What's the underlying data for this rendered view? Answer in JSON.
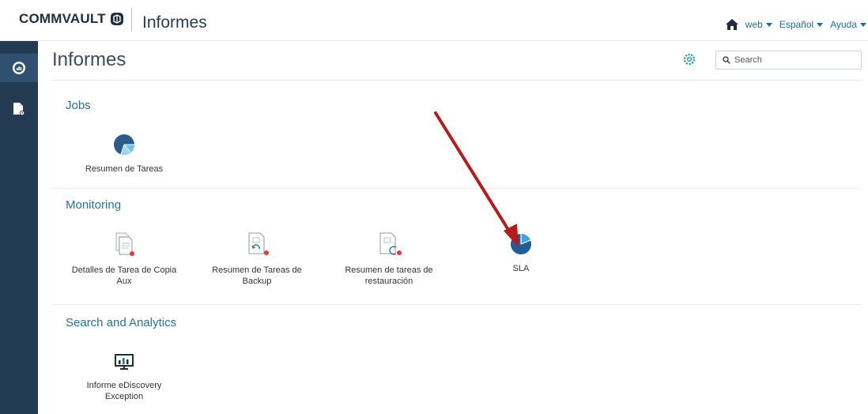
{
  "header": {
    "brand": "COMMVAULT",
    "app_title": "Informes",
    "menu": [
      {
        "label": "web"
      },
      {
        "label": "Español"
      },
      {
        "label": "Ayuda"
      }
    ]
  },
  "page": {
    "title": "Informes",
    "search_placeholder": "Search"
  },
  "sections": [
    {
      "title": "Jobs",
      "reports": [
        {
          "label": "Resumen de Tareas",
          "icon": "pie-chart-icon"
        }
      ]
    },
    {
      "title": "Monitoring",
      "reports": [
        {
          "label": "Detalles de Tarea de Copia Aux",
          "icon": "document-copy-icon"
        },
        {
          "label": "Resumen de Tareas de Backup",
          "icon": "document-backup-icon"
        },
        {
          "label": "Resumen de tareas de restauración",
          "icon": "document-restore-icon"
        },
        {
          "label": "SLA",
          "icon": "pie-chart-icon"
        }
      ]
    },
    {
      "title": "Search and Analytics",
      "reports": [
        {
          "label": "Informe eDiscovery Exception",
          "icon": "monitor-chart-icon"
        }
      ]
    }
  ],
  "colors": {
    "accent": "#2471a3",
    "rail": "#223a52",
    "status_dot": "#e53935",
    "annotation_arrow": "#b71c1c"
  }
}
